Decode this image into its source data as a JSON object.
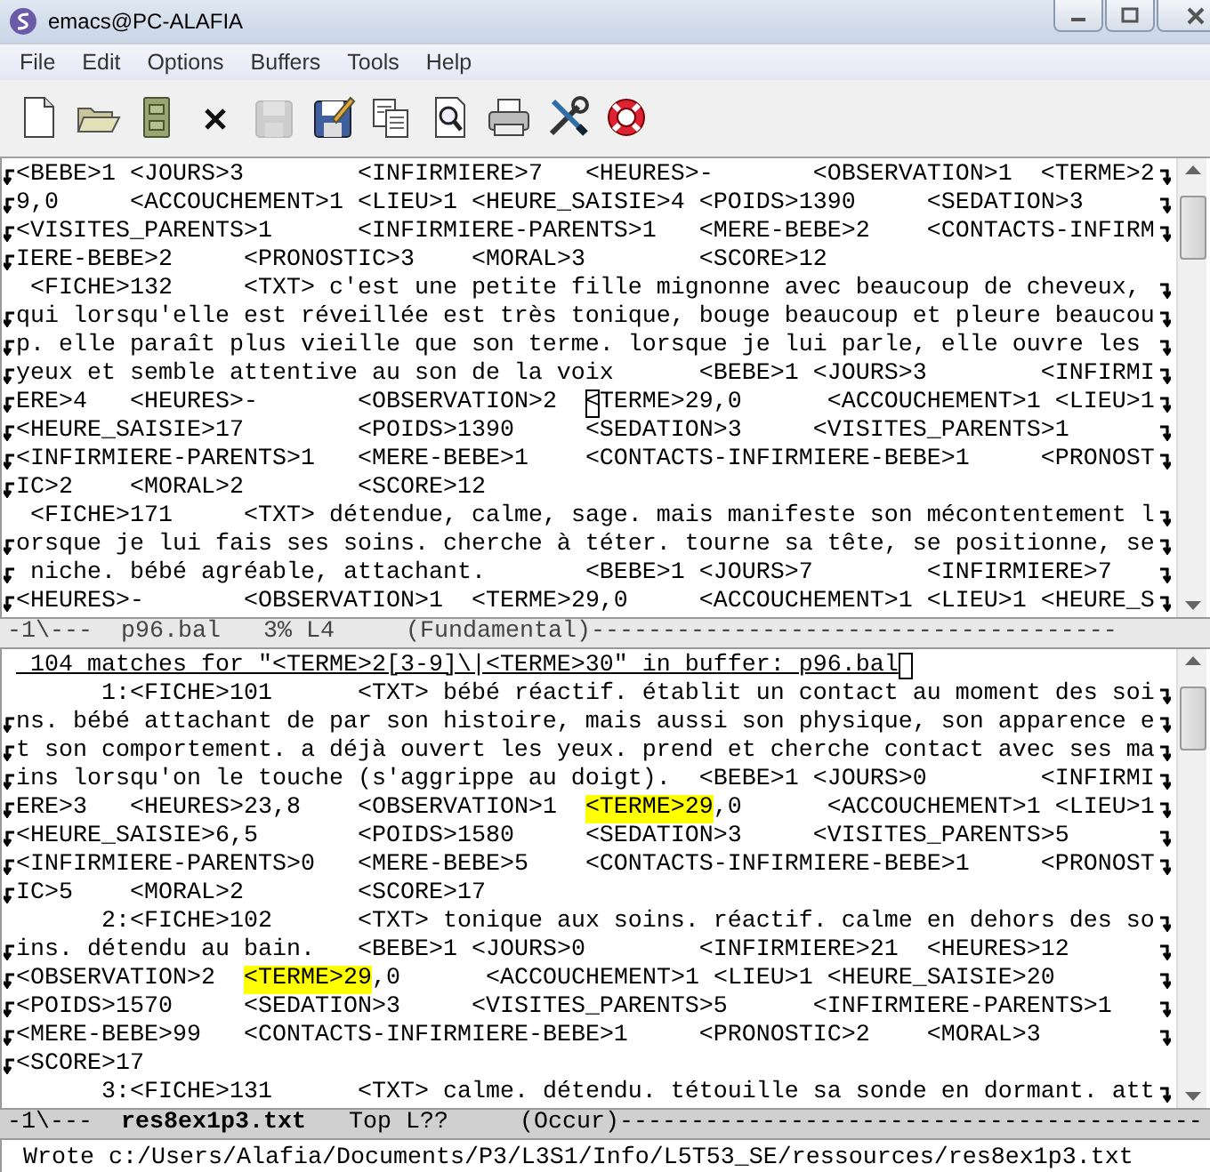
{
  "window": {
    "title": "emacs@PC-ALAFIA"
  },
  "menu": [
    "File",
    "Edit",
    "Options",
    "Buffers",
    "Tools",
    "Help"
  ],
  "toolbar": [
    {
      "kind": "new",
      "disabled": false
    },
    {
      "kind": "open",
      "disabled": false
    },
    {
      "kind": "cabinet",
      "disabled": false
    },
    {
      "kind": "close",
      "disabled": false
    },
    {
      "kind": "save",
      "disabled": true
    },
    {
      "kind": "saveas",
      "disabled": false
    },
    {
      "kind": "copy",
      "disabled": false
    },
    {
      "kind": "find",
      "disabled": false
    },
    {
      "kind": "print",
      "disabled": false
    },
    {
      "kind": "tools",
      "disabled": false
    },
    {
      "kind": "help",
      "disabled": false
    }
  ],
  "top_pane": {
    "lines": [
      {
        "cont": true,
        "wrap": true,
        "text": "<BEBE>1 <JOURS>3\t<INFIRMIERE>7\t<HEURES>-\t<OBSERVATION>1\t<TERME>2"
      },
      {
        "cont": true,
        "wrap": true,
        "text": "9,0\t<ACCOUCHEMENT>1 <LIEU>1 <HEURE_SAISIE>4 <POIDS>1390\t<SEDATION>3"
      },
      {
        "cont": true,
        "wrap": true,
        "text": "<VISITES_PARENTS>1\t<INFIRMIERE-PARENTS>1\t<MERE-BEBE>2\t<CONTACTS-INFIRM"
      },
      {
        "cont": true,
        "wrap": false,
        "text": "IERE-BEBE>2\t<PRONOSTIC>3\t<MORAL>3\t<SCORE>12"
      },
      {
        "cont": false,
        "wrap": true,
        "text": " <FICHE>132\t<TXT> c'est une petite fille mignonne avec beaucoup de cheveux, "
      },
      {
        "cont": true,
        "wrap": true,
        "text": "qui lorsqu'elle est réveillée est très tonique, bouge beaucoup et pleure beaucou"
      },
      {
        "cont": true,
        "wrap": true,
        "text": "p. elle paraît plus vieille que son terme. lorsque je lui parle, elle ouvre les "
      },
      {
        "cont": true,
        "wrap": true,
        "text": "yeux et semble attentive au son de la voix\t<BEBE>1 <JOURS>3\t<INFIRMI"
      },
      {
        "cont": true,
        "wrap": true,
        "parts": [
          {
            "kind": "plain",
            "text": "ERE>4\t<HEURES>-\t<OBSERVATION>2\t"
          },
          {
            "kind": "cursor",
            "text": "<"
          },
          {
            "kind": "plain",
            "text": "TERME>29,0\t<ACCOUCHEMENT>1 <LIEU>1"
          }
        ]
      },
      {
        "cont": true,
        "wrap": true,
        "text": "<HEURE_SAISIE>17\t<POIDS>1390\t<SEDATION>3\t<VISITES_PARENTS>1"
      },
      {
        "cont": true,
        "wrap": true,
        "text": "<INFIRMIERE-PARENTS>1\t<MERE-BEBE>1\t<CONTACTS-INFIRMIERE-BEBE>1\t<PRONOST"
      },
      {
        "cont": true,
        "wrap": false,
        "text": "IC>2\t<MORAL>2\t<SCORE>12"
      },
      {
        "cont": false,
        "wrap": true,
        "text": " <FICHE>171\t<TXT> détendue, calme, sage. mais manifeste son mécontentement l"
      },
      {
        "cont": true,
        "wrap": true,
        "text": "orsque je lui fais ses soins. cherche à téter. tourne sa tête, se positionne, se"
      },
      {
        "cont": true,
        "wrap": true,
        "text": " niche. bébé agréable, attachant.\t<BEBE>1 <JOURS>7\t<INFIRMIERE>7"
      },
      {
        "cont": true,
        "wrap": true,
        "text": "<HEURES>-\t<OBSERVATION>1\t<TERME>29,0\t<ACCOUCHEMENT>1 <LIEU>1 <HEURE_S"
      }
    ],
    "mode_line": {
      "active": false,
      "before": "-1\\---",
      "buffer": "p96.bal",
      "position": "3% L4",
      "mode": "(Fundamental)-------------------------------------"
    }
  },
  "bottom_pane": {
    "lines": [
      {
        "cont": false,
        "wrap": false,
        "underlined": true,
        "cursor_end": true,
        "text": " 104 matches for \"<TERME>2[3-9]\\|<TERME>30\" in buffer: p96.bal"
      },
      {
        "cont": false,
        "wrap": true,
        "text": "      1:<FICHE>101\t<TXT> bébé réactif. établit un contact au moment des soi"
      },
      {
        "cont": true,
        "wrap": true,
        "text": "ns. bébé attachant de par son histoire, mais aussi son physique, son apparence e"
      },
      {
        "cont": true,
        "wrap": true,
        "text": "t son comportement. a déjà ouvert les yeux. prend et cherche contact avec ses ma"
      },
      {
        "cont": true,
        "wrap": true,
        "text": "ins lorsqu'on le touche (s'aggrippe au doigt).\t<BEBE>1 <JOURS>0\t<INFIRMI"
      },
      {
        "cont": true,
        "wrap": true,
        "parts": [
          {
            "kind": "plain",
            "text": "ERE>3\t<HEURES>23,8\t<OBSERVATION>1\t"
          },
          {
            "kind": "match",
            "text": "<TERME>29"
          },
          {
            "kind": "plain",
            "text": ",0\t<ACCOUCHEMENT>1 <LIEU>1"
          }
        ]
      },
      {
        "cont": true,
        "wrap": true,
        "text": "<HEURE_SAISIE>6,5\t<POIDS>1580\t<SEDATION>3\t<VISITES_PARENTS>5"
      },
      {
        "cont": true,
        "wrap": true,
        "text": "<INFIRMIERE-PARENTS>0\t<MERE-BEBE>5\t<CONTACTS-INFIRMIERE-BEBE>1\t<PRONOST"
      },
      {
        "cont": true,
        "wrap": false,
        "text": "IC>5\t<MORAL>2\t<SCORE>17"
      },
      {
        "cont": false,
        "wrap": true,
        "text": "      2:<FICHE>102\t<TXT> tonique aux soins. réactif. calme en dehors des so"
      },
      {
        "cont": true,
        "wrap": true,
        "text": "ins. détendu au bain.\t<BEBE>1 <JOURS>0\t<INFIRMIERE>21\t<HEURES>12"
      },
      {
        "cont": true,
        "wrap": true,
        "parts": [
          {
            "kind": "plain",
            "text": "<OBSERVATION>2\t"
          },
          {
            "kind": "match",
            "text": "<TERME>29"
          },
          {
            "kind": "plain",
            "text": ",0\t<ACCOUCHEMENT>1 <LIEU>1 <HEURE_SAISIE>20"
          }
        ]
      },
      {
        "cont": true,
        "wrap": true,
        "text": "<POIDS>1570\t<SEDATION>3\t<VISITES_PARENTS>5\t<INFIRMIERE-PARENTS>1"
      },
      {
        "cont": true,
        "wrap": true,
        "text": "<MERE-BEBE>99\t<CONTACTS-INFIRMIERE-BEBE>1\t<PRONOSTIC>2\t<MORAL>3"
      },
      {
        "cont": true,
        "wrap": false,
        "text": "<SCORE>17"
      },
      {
        "cont": false,
        "wrap": true,
        "text": "      3:<FICHE>131\t<TXT> calme. détendu. tétouille sa sonde en dormant. att"
      }
    ],
    "mode_line": {
      "active": true,
      "before": "-1\\---",
      "buffer": "res8ex1p3.txt",
      "position": "Top L??",
      "mode": "(Occur)-----------------------------------------"
    }
  },
  "echo_area": "Wrote c:/Users/Alafia/Documents/P3/L3S1/Info/L5T53_SE/ressources/res8ex1p3.txt"
}
